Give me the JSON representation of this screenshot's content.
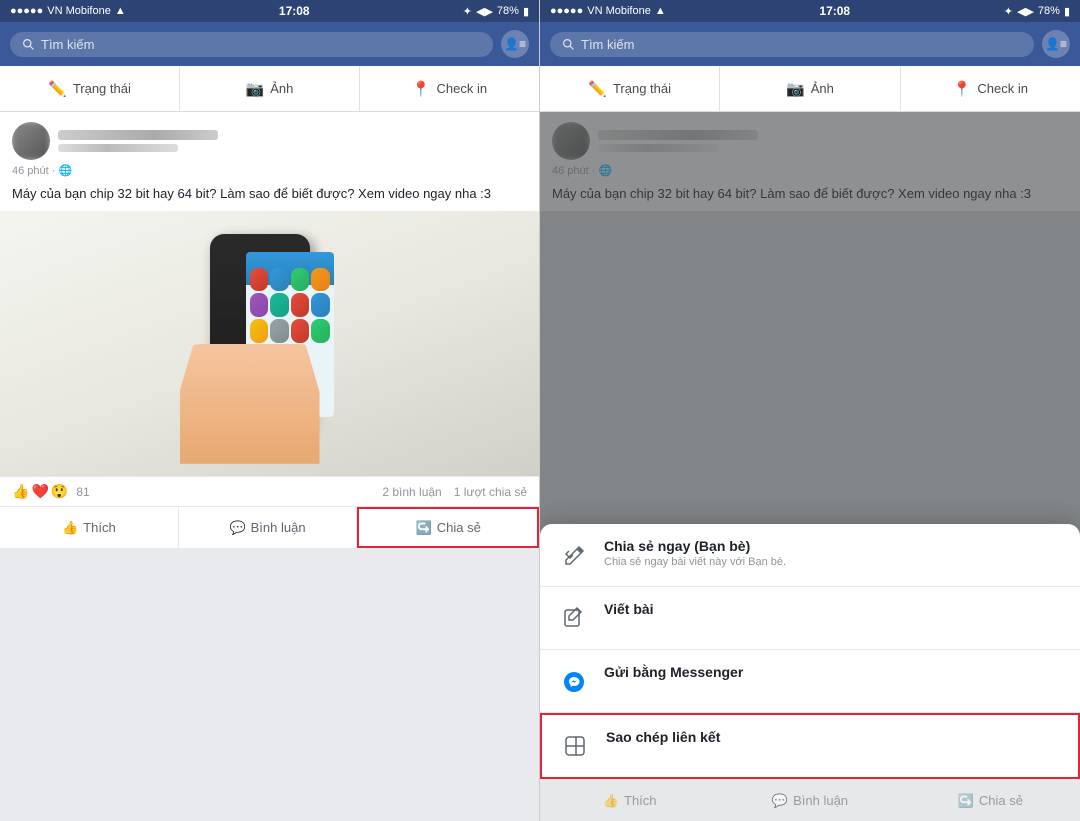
{
  "left_panel": {
    "status_bar": {
      "carrier": "VN Mobifone",
      "wifi": "WiFi",
      "time": "17:08",
      "battery": "78%"
    },
    "search": {
      "placeholder": "Tìm kiếm"
    },
    "action_bar": {
      "items": [
        {
          "label": "Trạng thái",
          "icon": "✏️"
        },
        {
          "label": "Ảnh",
          "icon": "📷"
        },
        {
          "label": "Check in",
          "icon": "📍"
        }
      ]
    },
    "post": {
      "time": "46 phút · 🌐",
      "text": "Máy của bạn chip 32 bit hay 64 bit? Làm sao để biết được? Xem video ngay nha :3",
      "reactions": {
        "icons": [
          "👍",
          "❤️",
          "😲"
        ],
        "count": "81",
        "comments": "2 bình luận",
        "shares": "1 lượt chia sẻ"
      },
      "actions": [
        {
          "label": "Thích",
          "icon": "👍"
        },
        {
          "label": "Bình luận",
          "icon": "💬"
        },
        {
          "label": "Chia sẻ",
          "icon": "↪️",
          "highlighted": true
        }
      ]
    }
  },
  "right_panel": {
    "status_bar": {
      "carrier": "VN Mobifone",
      "wifi": "WiFi",
      "time": "17:08",
      "battery": "78%"
    },
    "search": {
      "placeholder": "Tìm kiếm"
    },
    "action_bar": {
      "items": [
        {
          "label": "Trạng thái",
          "icon": "✏️"
        },
        {
          "label": "Ảnh",
          "icon": "📷"
        },
        {
          "label": "Check in",
          "icon": "📍"
        }
      ]
    },
    "post": {
      "time": "46 phút · 🌐",
      "text": "Máy của bạn chip 32 bit hay 64 bit? Làm sao để biết được? Xem video ngay nha :3"
    },
    "share_menu": {
      "options": [
        {
          "id": "share-now",
          "title": "Chia sẻ ngay (Bạn bè)",
          "subtitle": "Chia sẻ ngay bài viết này với Bạn bè.",
          "icon": "🔄"
        },
        {
          "id": "write-post",
          "title": "Viết bài",
          "subtitle": "",
          "icon": "✏️"
        },
        {
          "id": "messenger",
          "title": "Gửi bằng Messenger",
          "subtitle": "",
          "icon": "💬"
        },
        {
          "id": "copy-link",
          "title": "Sao chép liên kết",
          "subtitle": "",
          "icon": "⊕",
          "highlighted": true
        }
      ]
    },
    "post_actions": [
      {
        "label": "Thích",
        "icon": "👍"
      },
      {
        "label": "Bình luận",
        "icon": "💬"
      },
      {
        "label": "Chia sẻ",
        "icon": "↪️"
      }
    ]
  }
}
